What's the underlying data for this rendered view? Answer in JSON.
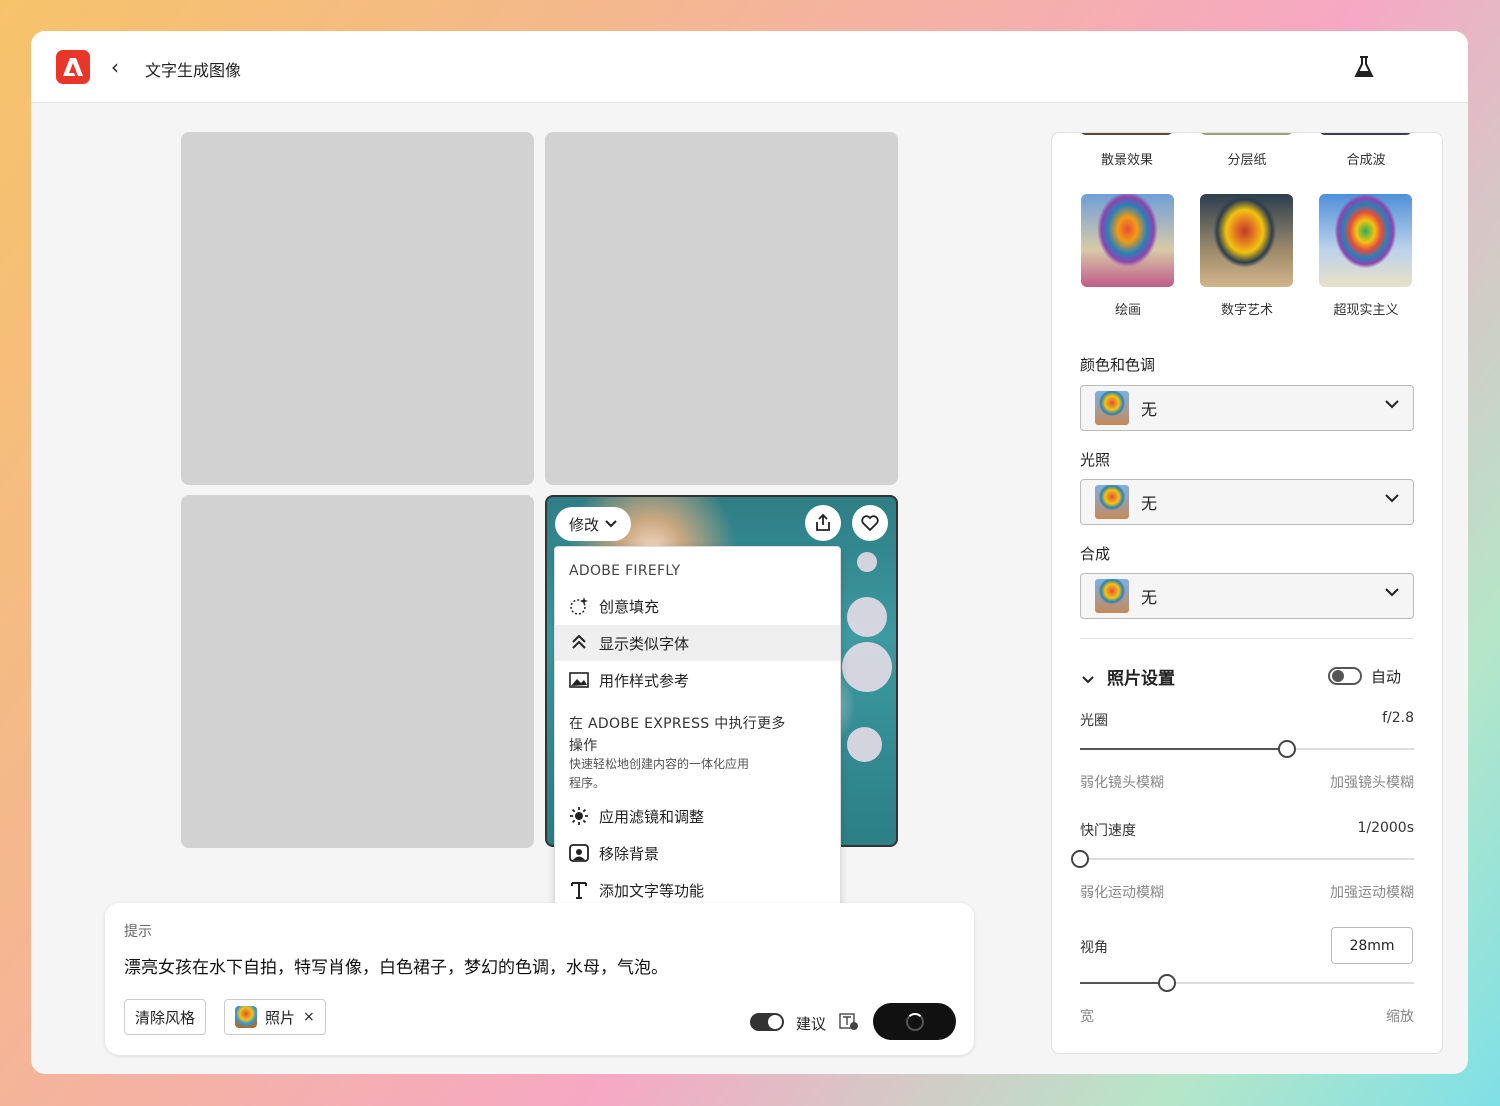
{
  "header": {
    "title": "文字生成图像"
  },
  "card": {
    "modify_label": "修改"
  },
  "menu": {
    "section_firefly": "ADOBE FIREFLY",
    "items_firefly": [
      "创意填充",
      "显示类似字体",
      "用作样式参考"
    ],
    "section_express_line1": "在 ADOBE EXPRESS 中执行更多",
    "section_express_line2": "操作",
    "section_express_desc_line1": "快速轻松地创建内容的一体化应用",
    "section_express_desc_line2": "程序。",
    "items_express": [
      "应用滤镜和调整",
      "移除背景",
      "添加文字等功能"
    ]
  },
  "prompt": {
    "label": "提示",
    "text": "漂亮女孩在水下自拍，特写肖像，白色裙子，梦幻的色调，水母，气泡。",
    "clear_style": "清除风格",
    "style_chip": "照片",
    "remove_symbol": "×",
    "suggest_label": "建议",
    "suggest_on": true
  },
  "panel": {
    "styles_top": [
      "散景效果",
      "分层纸",
      "合成波"
    ],
    "styles": [
      "绘画",
      "数字艺术",
      "超现实主义"
    ],
    "color_tone": {
      "label": "颜色和色调",
      "value": "无"
    },
    "lighting": {
      "label": "光照",
      "value": "无"
    },
    "composition": {
      "label": "合成",
      "value": "无"
    },
    "photo_settings": {
      "title": "照片设置",
      "auto_label": "自动",
      "auto_on": false,
      "aperture": {
        "label": "光圈",
        "value": "f/2.8",
        "min": "弱化镜头模糊",
        "max": "加强镜头模糊",
        "level": 0.62
      },
      "shutter": {
        "label": "快门速度",
        "value": "1/2000s",
        "min": "弱化运动模糊",
        "max": "加强运动模糊",
        "level": 0.0
      },
      "fov": {
        "label": "视角",
        "value": "28mm",
        "min": "宽",
        "max": "缩放",
        "level": 0.26
      }
    }
  },
  "colors": {
    "accent": "#e8362b",
    "generate_button": "#111111"
  }
}
